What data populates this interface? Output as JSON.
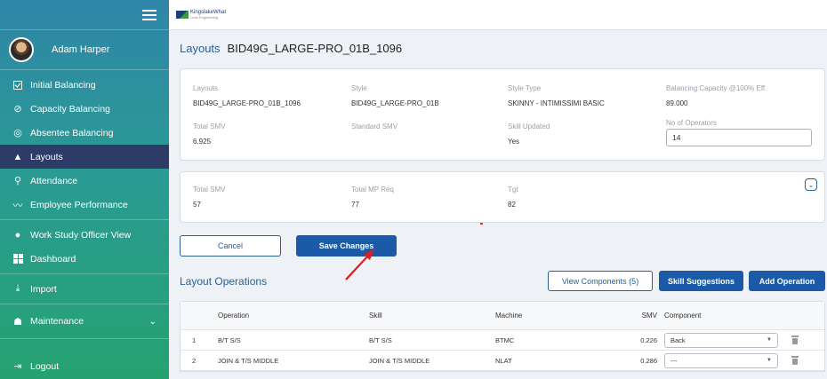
{
  "user": {
    "name": "Adam  Harper"
  },
  "logo": {
    "name": "KingslakeWhat",
    "tagline": "Lean Engineering"
  },
  "sidebar": {
    "items": [
      {
        "label": "Initial Balancing"
      },
      {
        "label": "Capacity Balancing"
      },
      {
        "label": "Absentee Balancing"
      },
      {
        "label": "Layouts"
      },
      {
        "label": "Attendance"
      },
      {
        "label": "Employee Performance"
      },
      {
        "label": "Work Study Officer View"
      },
      {
        "label": "Dashboard"
      },
      {
        "label": "Import"
      },
      {
        "label": "Maintenance"
      },
      {
        "label": "Logout"
      }
    ],
    "active": "Layouts"
  },
  "page": {
    "title": "Layouts",
    "layout_id": "BID49G_LARGE-PRO_01B_1096"
  },
  "details": {
    "layouts_label": "Layouts",
    "layouts_value": "BID49G_LARGE-PRO_01B_1096",
    "style_label": "Style",
    "style_value": "BID49G_LARGE-PRO_01B",
    "style_type_label": "Style Type",
    "style_type_value": "SKINNY - INTIMISSIMI BASIC",
    "balancing_label": "Balancing Capacity @100% Eff.",
    "balancing_value": "89.000",
    "total_smv_label": "Total SMV",
    "total_smv_value": "6.925",
    "standard_smv_label": "Standard SMV",
    "standard_smv_value": "",
    "skill_updated_label": "Skill Updated",
    "skill_updated_value": "Yes",
    "operators_label": "No of Operators",
    "operators_value": "14"
  },
  "summary": {
    "total_smv_label": "Total SMV",
    "total_smv_value": "57",
    "total_mp_label": "Total MP Req",
    "total_mp_value": "77",
    "tgt_label": "Tgt",
    "tgt_value": "82"
  },
  "buttons": {
    "cancel": "Cancel",
    "save": "Save Changes",
    "view_components": "View Components (5)",
    "skill_suggestions": "Skill Suggestions",
    "add_operation": "Add Operation"
  },
  "operations": {
    "title": "Layout Operations",
    "columns": {
      "operation": "Operation",
      "skill": "Skill",
      "machine": "Machine",
      "smv": "SMV",
      "component": "Component"
    },
    "rows": [
      {
        "no": "1",
        "operation": "B/T S/S",
        "skill": "B/T S/S",
        "machine": "BTMC",
        "smv": "0.226",
        "component": "Back"
      },
      {
        "no": "2",
        "operation": "JOIN & T/S MIDDLE",
        "skill": "JOIN & T/S MIDDLE",
        "machine": "NLAT",
        "smv": "0.286",
        "component": "---"
      }
    ]
  },
  "colors": {
    "primary": "#1b5aa6",
    "active_nav": "#2d3c66",
    "sidebar_top": "#2f86a8",
    "sidebar_bottom": "#26a271"
  }
}
